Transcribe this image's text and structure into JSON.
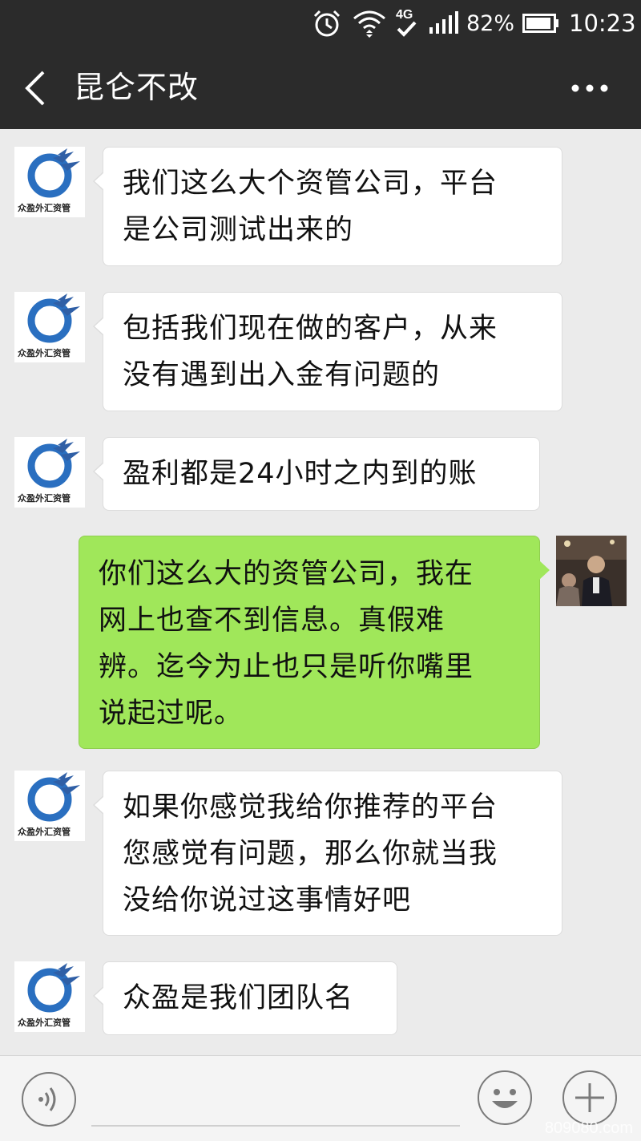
{
  "status_bar": {
    "battery_percent": "82%",
    "time": "10:23",
    "icons": [
      "alarm-icon",
      "wifi-icon",
      "4g-icon",
      "signal-icon",
      "battery-icon"
    ]
  },
  "header": {
    "title": "昆仑不改"
  },
  "messages": [
    {
      "side": "left",
      "avatar_caption": "众盈外汇资管",
      "lines": [
        "我们这么大个资管公司，平台",
        "是公司测试出来的"
      ]
    },
    {
      "side": "left",
      "avatar_caption": "众盈外汇资管",
      "lines": [
        "包括我们现在做的客户，从来",
        "没有遇到出入金有问题的"
      ]
    },
    {
      "side": "left",
      "avatar_caption": "众盈外汇资管",
      "lines": [
        "盈利都是24小时之内到的账"
      ]
    },
    {
      "side": "right",
      "lines": [
        "你们这么大的资管公司，我在",
        "网上也查不到信息。真假难",
        "辨。迄今为止也只是听你嘴里",
        "说起过呢。"
      ]
    },
    {
      "side": "left",
      "avatar_caption": "众盈外汇资管",
      "lines": [
        "如果你感觉我给你推荐的平台",
        "您感觉有问题，那么你就当我",
        "没给你说过这事情好吧"
      ]
    },
    {
      "side": "left",
      "avatar_caption": "众盈外汇资管",
      "lines": [
        "众盈是我们团队名"
      ]
    }
  ],
  "footer": {
    "watermark": "809080.com"
  },
  "colors": {
    "bar_bg": "#2b2b2b",
    "chat_bg": "#ebebeb",
    "bubble_self": "#a0e75a",
    "bubble_other": "#ffffff"
  }
}
